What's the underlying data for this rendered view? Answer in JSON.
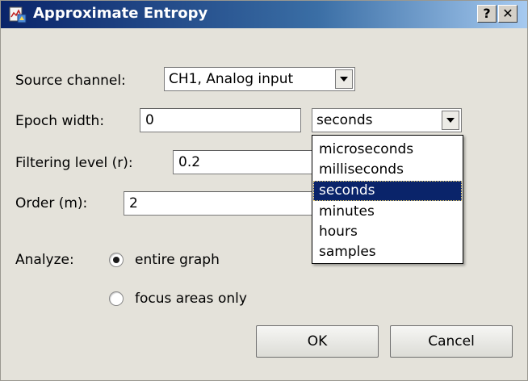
{
  "window": {
    "title": "Approximate Entropy",
    "help_label": "?",
    "close_label": "✕"
  },
  "source": {
    "label": "Source channel:",
    "value": "CH1, Analog input"
  },
  "epoch": {
    "label": "Epoch width:",
    "value": "0",
    "unit": "seconds"
  },
  "filtering": {
    "label": "Filtering level (r):",
    "value": "0.2"
  },
  "order": {
    "label": "Order (m):",
    "value": "2"
  },
  "unit_options": [
    "microseconds",
    "milliseconds",
    "seconds",
    "minutes",
    "hours",
    "samples"
  ],
  "selected_unit_index": 2,
  "analyze": {
    "label": "Analyze:",
    "options": [
      "entire graph",
      "focus areas only"
    ],
    "selected_index": 0
  },
  "buttons": {
    "ok": "OK",
    "cancel": "Cancel"
  }
}
